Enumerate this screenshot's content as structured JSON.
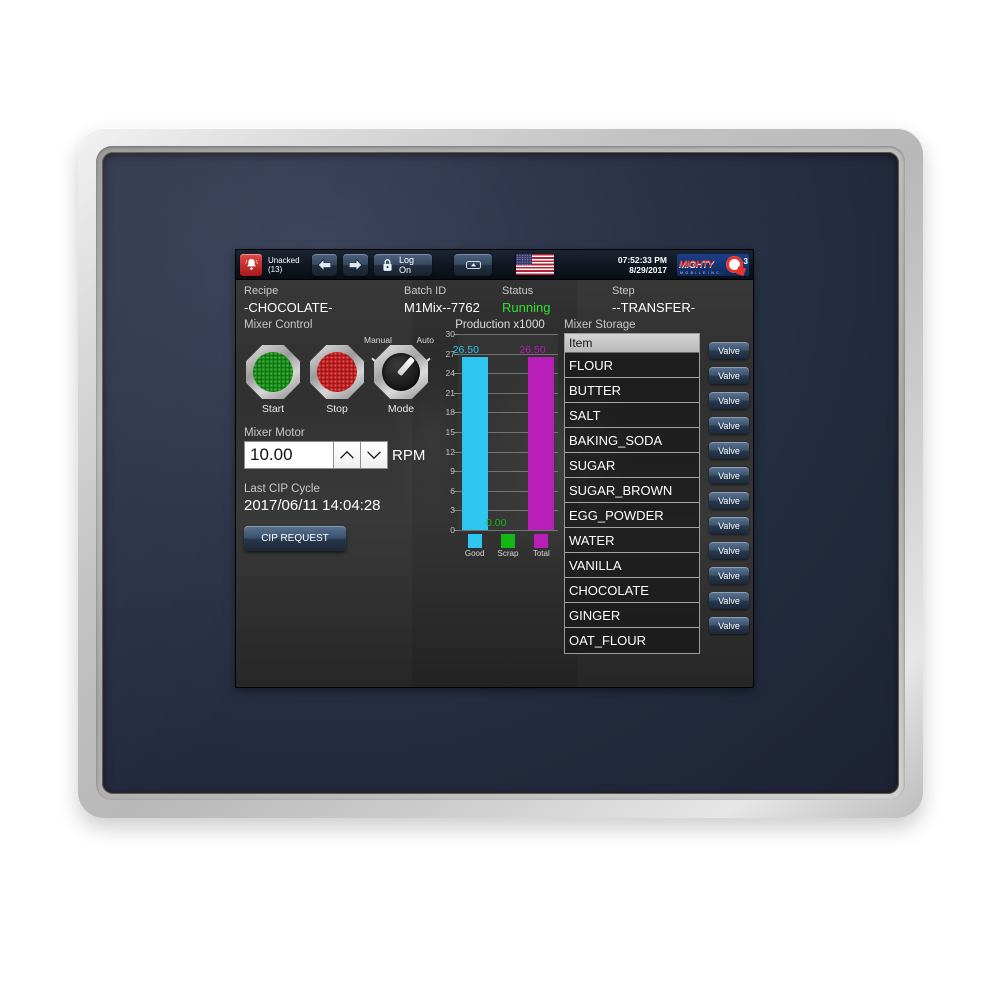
{
  "toolbar": {
    "alarm_icon": "alarm-bell-icon",
    "alarm_label": "Unacked",
    "alarm_count": "(13)",
    "back_icon": "left-arrow-icon",
    "forward_icon": "right-arrow-icon",
    "lock_icon": "padlock-icon",
    "logon_label": "Log On",
    "eject_icon": "eject-icon",
    "flag_icon": "usa-flag-icon",
    "time": "07:52:33 PM",
    "date": "8/29/2017",
    "logo_word": "MIGHTY",
    "logo_sub": "M O B I L E   I N C .",
    "logo_superscript": "3"
  },
  "header": {
    "recipe_label": "Recipe",
    "recipe_value": "-CHOCOLATE-",
    "batch_label": "Batch ID",
    "batch_value": "M1Mix--7762",
    "status_label": "Status",
    "status_value": "Running",
    "status_color": "#2ee02e",
    "step_label": "Step",
    "step_value": "--TRANSFER-"
  },
  "mixer_control": {
    "title": "Mixer Control",
    "buttons": [
      {
        "caption": "Start",
        "icon": "green-pushbutton-icon",
        "color": "#1b8b1b"
      },
      {
        "caption": "Stop",
        "icon": "red-pushbutton-icon",
        "color": "#c22222"
      }
    ],
    "selector": {
      "caption": "Mode",
      "icon": "rotary-selector-icon",
      "left_label": "Manual",
      "right_label": "Auto",
      "position": "Auto"
    }
  },
  "mixer_motor": {
    "title": "Mixer Motor",
    "value": "10.00",
    "unit": "RPM",
    "up_icon": "chevron-up-icon",
    "down_icon": "chevron-down-icon"
  },
  "cip": {
    "title": "Last CIP Cycle",
    "date": "2017/06/11 14:04:28",
    "button_label": "CIP REQUEST"
  },
  "chart_data": {
    "type": "bar",
    "title": "Production x1000",
    "xlabel": "",
    "ylabel": "",
    "ylim": [
      0,
      30
    ],
    "yticks": [
      30,
      27,
      24,
      21,
      18,
      15,
      12,
      9,
      6,
      3,
      0
    ],
    "grid": true,
    "legend_position": "bottom",
    "categories": [
      "Good",
      "Scrap",
      "Total"
    ],
    "values": [
      26.5,
      0.0,
      26.5
    ],
    "data_labels": [
      "26.50",
      "0.00",
      "26.50"
    ],
    "colors": [
      "#2ec6f0",
      "#14b814",
      "#b81fb8"
    ]
  },
  "storage": {
    "title": "Mixer Storage",
    "column_header": "Item",
    "valve_label": "Valve",
    "items": [
      "FLOUR",
      "BUTTER",
      "SALT",
      "BAKING_SODA",
      "SUGAR",
      "SUGAR_BROWN",
      "EGG_POWDER",
      "WATER",
      "VANILLA",
      "CHOCOLATE",
      "GINGER",
      "OAT_FLOUR"
    ]
  }
}
